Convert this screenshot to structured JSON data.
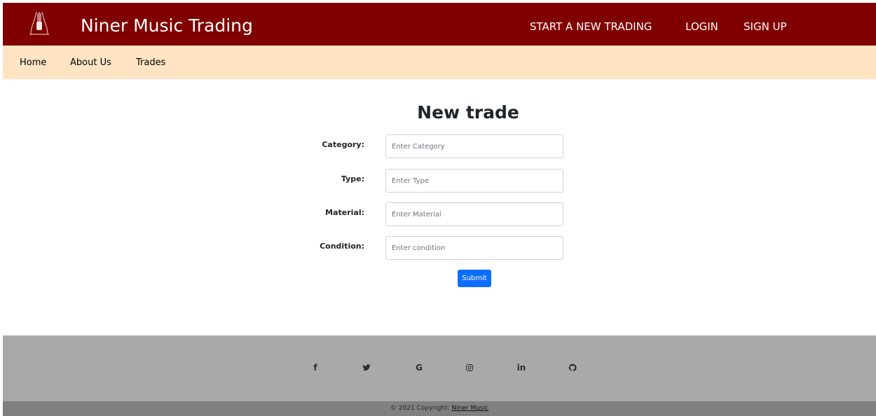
{
  "header": {
    "brand": "Niner Music Trading",
    "logo_icon": "guitar-logo-icon",
    "nav": {
      "start_trading": "START A NEW TRADING",
      "login": "LOGIN",
      "signup": "SIGN UP"
    }
  },
  "subnav": {
    "home": "Home",
    "about": "About Us",
    "trades": "Trades"
  },
  "form": {
    "title": "New trade",
    "category": {
      "label": "Category:",
      "placeholder": "Enter Category"
    },
    "type": {
      "label": "Type:",
      "placeholder": "Enter Type"
    },
    "material": {
      "label": "Material:",
      "placeholder": "Enter Material"
    },
    "condition": {
      "label": "Condition:",
      "placeholder": "Enter condition"
    },
    "submit": "Submit"
  },
  "footer": {
    "social": {
      "facebook": "f",
      "twitter": "twitter-icon",
      "google": "G",
      "instagram": "instagram-icon",
      "linkedin": "in",
      "github": "github-icon"
    },
    "copyright_prefix": "© 2021 Copyright: ",
    "copyright_link": "Niner Music"
  },
  "colors": {
    "header_bg": "#800000",
    "subnav_bg": "#ffe4c4",
    "button_bg": "#0d6efd",
    "footer_bg": "#a9a9a9",
    "footer_bottom_bg": "#808080"
  }
}
